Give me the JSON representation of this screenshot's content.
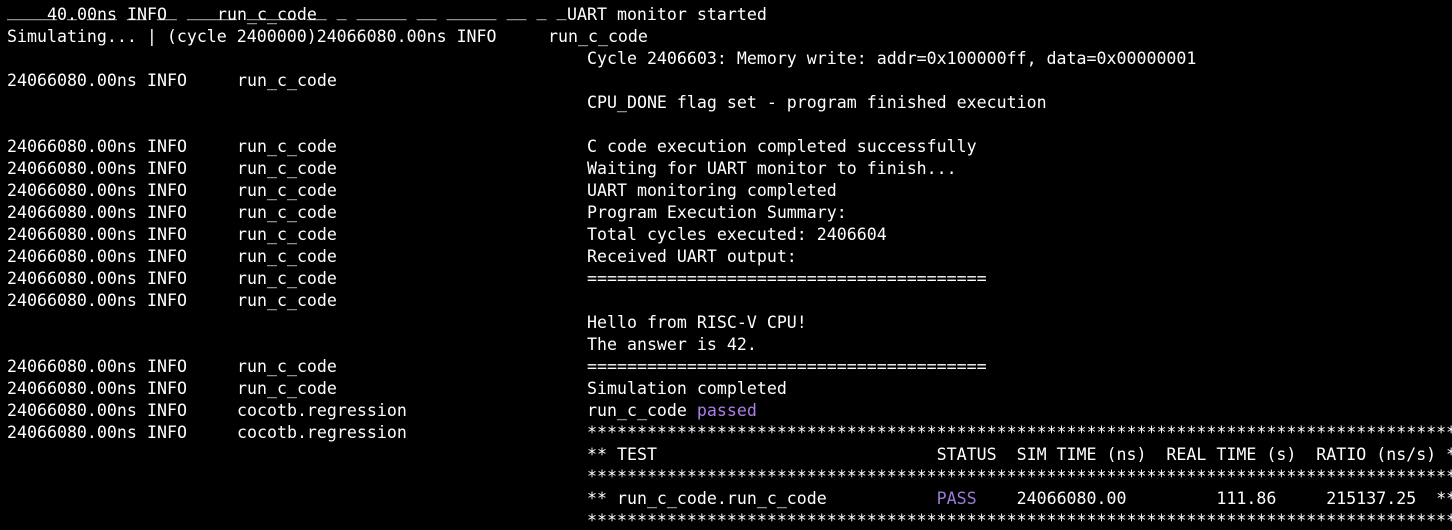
{
  "colors": {
    "background": "#000000",
    "text": "#ffffff",
    "passed": "#ad7fe8",
    "pass_status": "#9b7bd6"
  },
  "cut_top": "_____ _ ___ __ __ _____ _____ __ _ _____ __ _____ __ _ _",
  "header": {
    "ts": "40.00ns",
    "level": "INFO",
    "source": "run_c_code",
    "message": "UART monitor started"
  },
  "simulating": {
    "prefix": "Simulating... | (cycle 2400000)24066080.00ns INFO",
    "source": "run_c_code"
  },
  "memory_write": "Cycle 2406603: Memory write: addr=0x100000ff, data=0x00000001",
  "cpu_done_row": {
    "ts": "24066080.00ns",
    "level": "INFO",
    "source": "run_c_code"
  },
  "cpu_done_msg": "CPU_DONE flag set - program finished execution",
  "log_rows": [
    {
      "ts": "24066080.00ns",
      "level": "INFO",
      "source": "run_c_code",
      "message": "C code execution completed successfully"
    },
    {
      "ts": "24066080.00ns",
      "level": "INFO",
      "source": "run_c_code",
      "message": "Waiting for UART monitor to finish..."
    },
    {
      "ts": "24066080.00ns",
      "level": "INFO",
      "source": "run_c_code",
      "message": "UART monitoring completed"
    },
    {
      "ts": "24066080.00ns",
      "level": "INFO",
      "source": "run_c_code",
      "message": "Program Execution Summary:"
    },
    {
      "ts": "24066080.00ns",
      "level": "INFO",
      "source": "run_c_code",
      "message": "Total cycles executed: 2406604"
    },
    {
      "ts": "24066080.00ns",
      "level": "INFO",
      "source": "run_c_code",
      "message": "Received UART output:"
    },
    {
      "ts": "24066080.00ns",
      "level": "INFO",
      "source": "run_c_code",
      "message": "========================================"
    },
    {
      "ts": "24066080.00ns",
      "level": "INFO",
      "source": "run_c_code",
      "message": ""
    }
  ],
  "uart_output": [
    "Hello from RISC-V CPU!",
    "The answer is 42."
  ],
  "tail_rows": [
    {
      "ts": "24066080.00ns",
      "level": "INFO",
      "source": "run_c_code",
      "message": "========================================"
    },
    {
      "ts": "24066080.00ns",
      "level": "INFO",
      "source": "run_c_code",
      "message": "Simulation completed"
    },
    {
      "ts": "24066080.00ns",
      "level": "INFO",
      "source": "cocotb.regression",
      "message": "run_c_code"
    },
    {
      "ts": "24066080.00ns",
      "level": "INFO",
      "source": "cocotb.regression",
      "message": "****************************************************************************************"
    }
  ],
  "passed_word": "passed",
  "summary": {
    "header": "** TEST                            STATUS  SIM TIME (ns)  REAL TIME (s)  RATIO (ns/s) **",
    "separator": "****************************************************************************************",
    "row_name": "** run_c_code.run_c_code           ",
    "row_status": "PASS",
    "row_values": "    24066080.00         111.86     215137.25  **"
  }
}
